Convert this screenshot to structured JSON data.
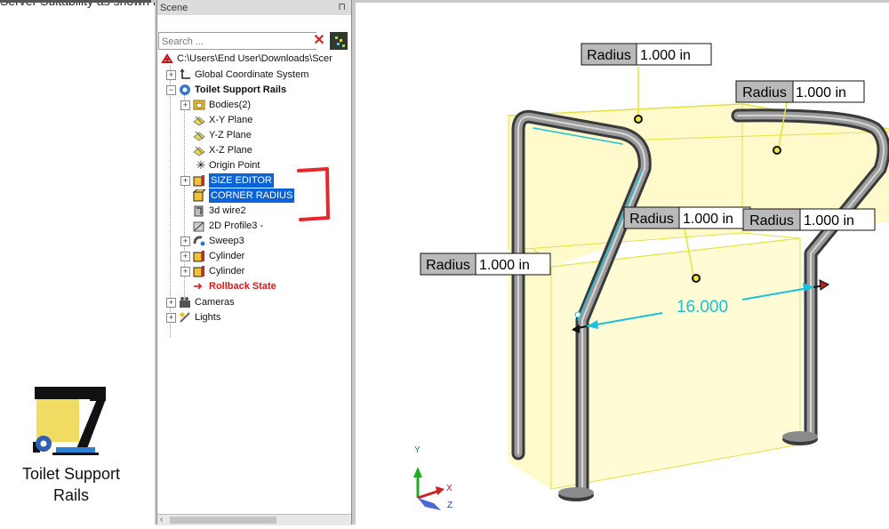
{
  "caption": "Server Suitability as shown below:",
  "desktop_icon": {
    "label": "Toilet Support Rails"
  },
  "scene_panel": {
    "title": "Scene",
    "pin": "⊓",
    "search_placeholder": "Search ...",
    "tree": [
      {
        "label": "C:\\Users\\End User\\Downloads\\Scer",
        "icon": "scene-root-icon"
      },
      {
        "label": "Global Coordinate System",
        "icon": "coordinate-system-icon"
      },
      {
        "label": "Toilet Support Rails",
        "icon": "assembly-icon"
      },
      {
        "label": "Bodies(2)",
        "icon": "bodies-folder-icon"
      },
      {
        "label": "X-Y Plane",
        "icon": "plane-icon"
      },
      {
        "label": "Y-Z Plane",
        "icon": "plane-icon"
      },
      {
        "label": "X-Z Plane",
        "icon": "plane-icon"
      },
      {
        "label": "Origin Point",
        "icon": "origin-point-icon"
      },
      {
        "label": "SIZE EDITOR",
        "icon": "size-editor-icon"
      },
      {
        "label": "CORNER RADIUS",
        "icon": "corner-radius-icon"
      },
      {
        "label": "3d wire2",
        "icon": "wire-icon"
      },
      {
        "label": "2D Profile3 -",
        "icon": "profile-icon"
      },
      {
        "label": "Sweep3",
        "icon": "sweep-icon"
      },
      {
        "label": "Cylinder",
        "icon": "cylinder-icon"
      },
      {
        "label": "Cylinder",
        "icon": "cylinder-icon"
      },
      {
        "label": "Rollback State",
        "icon": "rollback-arrow-icon"
      },
      {
        "label": "Cameras",
        "icon": "cameras-icon"
      },
      {
        "label": "Lights",
        "icon": "lights-icon"
      }
    ]
  },
  "viewport": {
    "radius_labels": [
      {
        "key": "Radius",
        "value": "1.000 in"
      },
      {
        "key": "Radius",
        "value": "1.000 in"
      },
      {
        "key": "Radius",
        "value": "1.000 in"
      },
      {
        "key": "Radius",
        "value": "1.000 in"
      },
      {
        "key": "Radius",
        "value": "1.000 in"
      }
    ],
    "dimension": "16.000",
    "axes": {
      "x": "X",
      "y": "Y",
      "z": "Z"
    }
  },
  "colors": {
    "selection": "#0a64d8",
    "highlight_box": "#fff6a0",
    "dimension": "#19c2d9",
    "annotation_red": "#e8262c"
  }
}
